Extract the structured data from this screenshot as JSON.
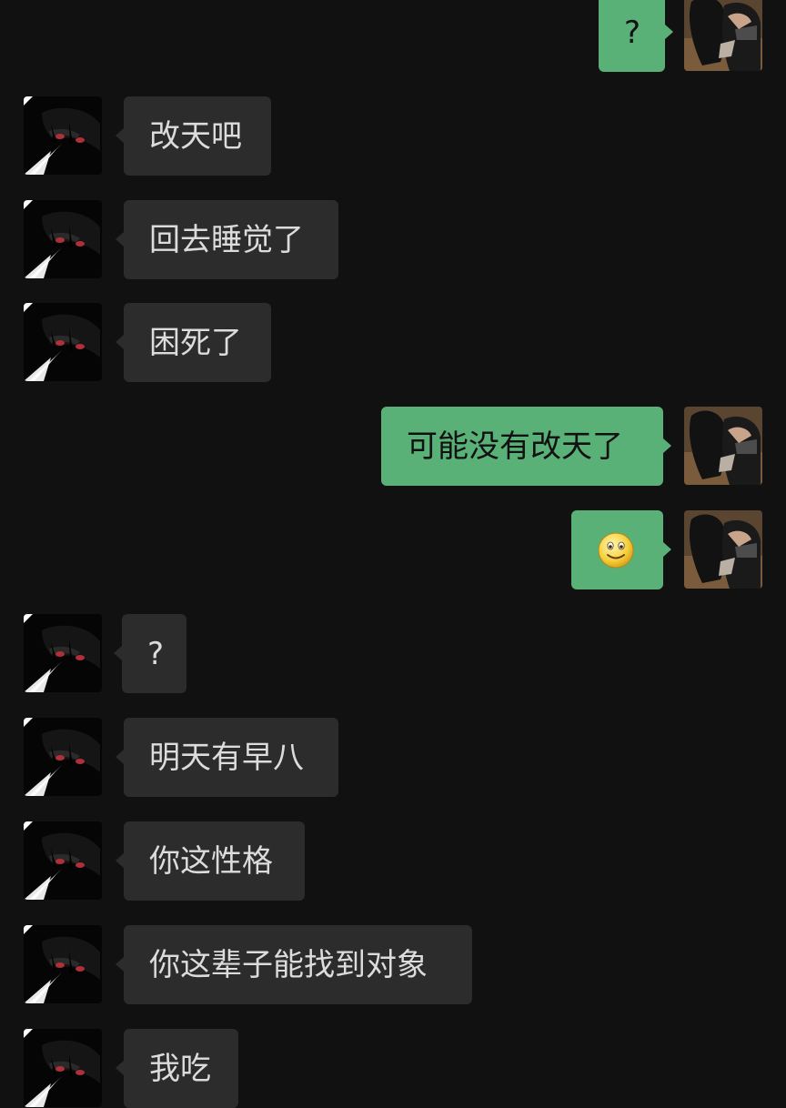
{
  "messages": [
    {
      "side": "out",
      "text": "?"
    },
    {
      "side": "in",
      "text": "改天吧"
    },
    {
      "side": "in",
      "text": "回去睡觉了"
    },
    {
      "side": "in",
      "text": "困死了"
    },
    {
      "side": "out",
      "text": "可能没有改天了"
    },
    {
      "side": "out",
      "emoji": "smiley-emoji"
    },
    {
      "side": "in",
      "text": "?"
    },
    {
      "side": "in",
      "text": "明天有早八"
    },
    {
      "side": "in",
      "text": "你这性格"
    },
    {
      "side": "in",
      "text": "你这辈子能找到对象"
    },
    {
      "side": "in",
      "text": "我吃"
    }
  ],
  "colors": {
    "background": "#111111",
    "incoming_bubble": "#2c2c2c",
    "outgoing_bubble": "#5ab177",
    "incoming_text": "#dcdcdc",
    "outgoing_text": "#111111"
  }
}
